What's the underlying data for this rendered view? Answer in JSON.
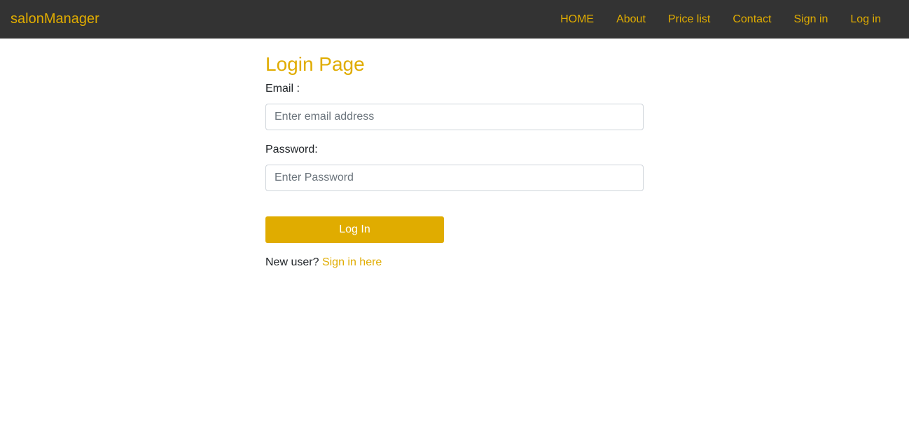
{
  "colors": {
    "accent": "#e0ac00",
    "navbar_bg": "#333333",
    "button_text": "#ffffff"
  },
  "navbar": {
    "brand": "salonManager",
    "links": [
      {
        "label": "HOME"
      },
      {
        "label": "About"
      },
      {
        "label": "Price list"
      },
      {
        "label": "Contact"
      },
      {
        "label": "Sign in"
      },
      {
        "label": "Log in"
      }
    ]
  },
  "login": {
    "title": "Login Page",
    "email_label": "Email :",
    "email_placeholder": "Enter email address",
    "email_value": "",
    "password_label": "Password:",
    "password_placeholder": "Enter Password",
    "password_value": "",
    "submit_label": "Log In",
    "new_user_text": "New user?",
    "signup_link": "Sign in here"
  }
}
